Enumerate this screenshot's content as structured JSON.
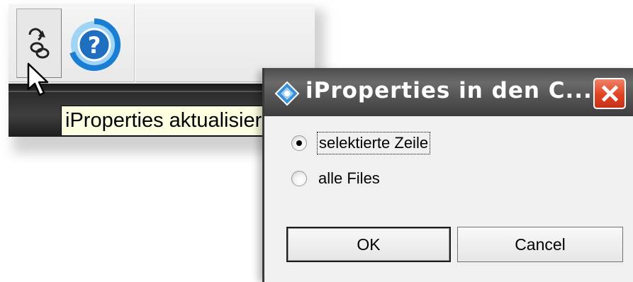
{
  "toolbar": {
    "update_tool": {
      "icon": "update-link-icon"
    },
    "help_tool": {
      "icon": "help-icon",
      "color": "#1a7fd4"
    },
    "tooltip": "iProperties aktualisieren"
  },
  "dialog": {
    "title": "iProperties in den C...",
    "title_icon": "app-icon",
    "close_icon": "close-icon",
    "options": [
      {
        "label": "selektierte Zeile",
        "checked": true
      },
      {
        "label": "alle Files",
        "checked": false
      }
    ],
    "ok_label": "OK",
    "cancel_label": "Cancel"
  },
  "colors": {
    "tooltip_bg": "#ffffe1",
    "close_red": "#e0431f",
    "titlebar": "#555555"
  }
}
